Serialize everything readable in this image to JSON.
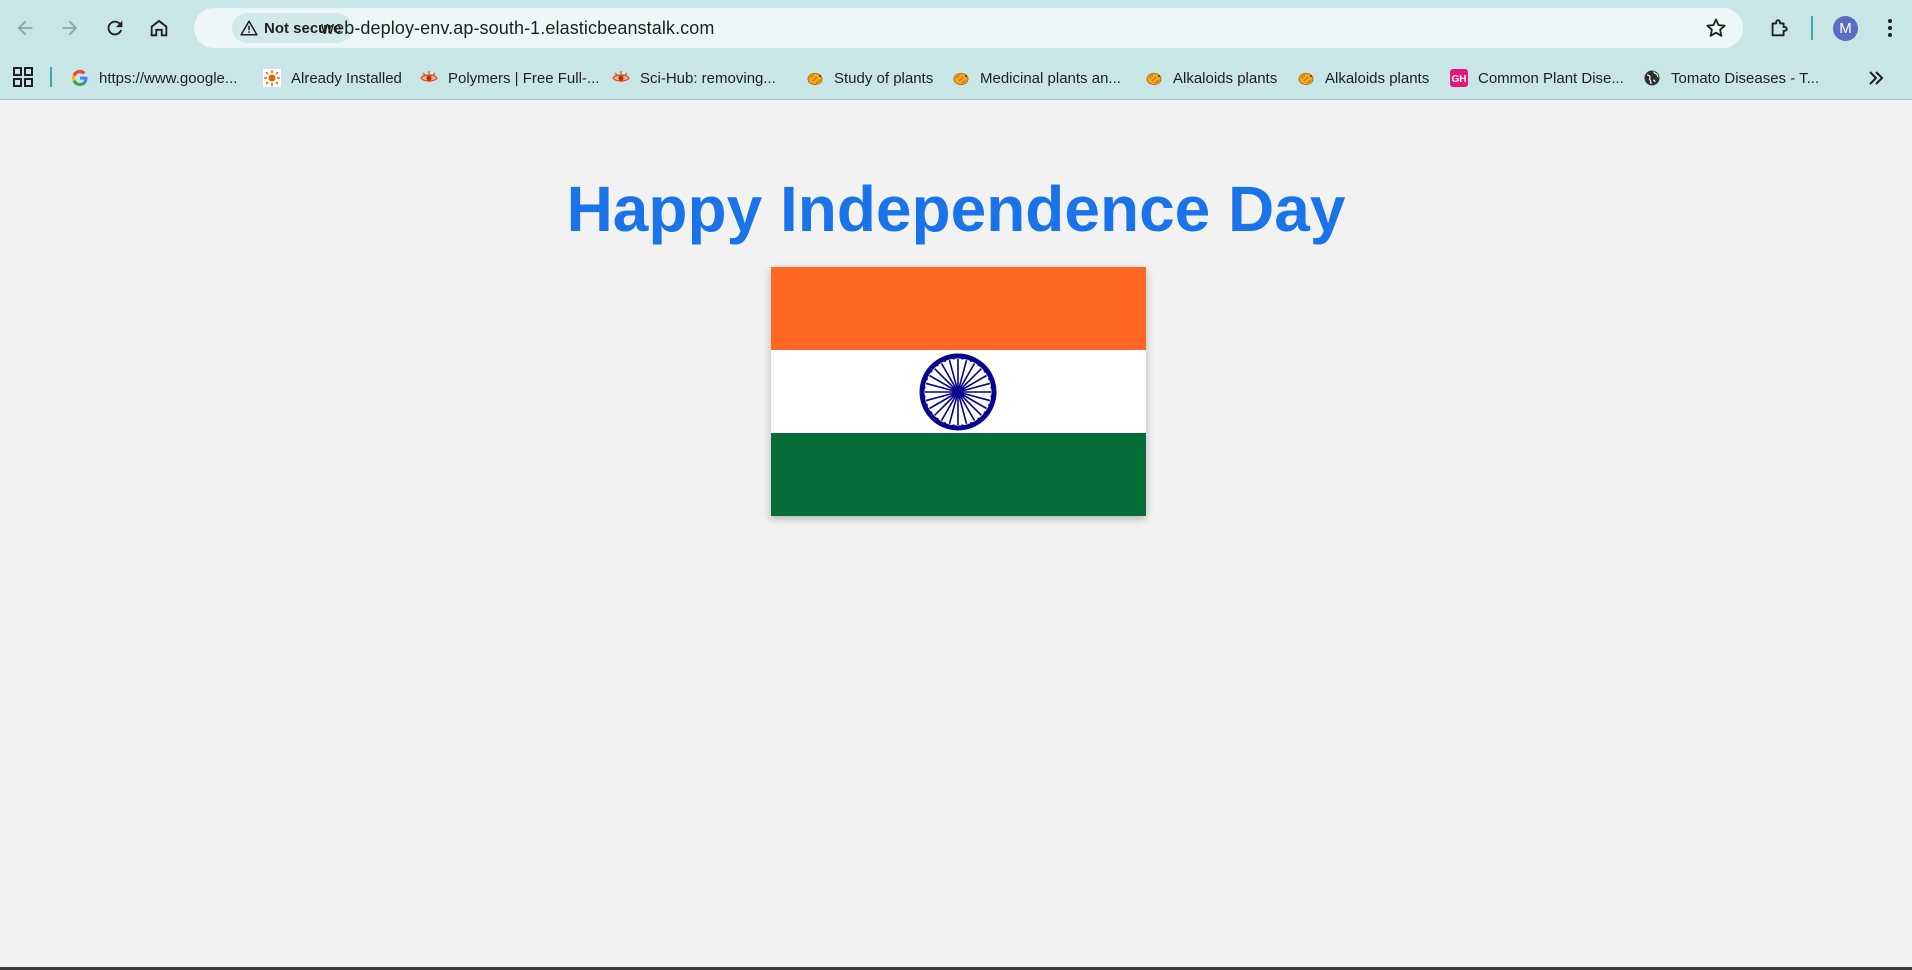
{
  "browser": {
    "security_label": "Not secure",
    "url": "web-deploy-env.ap-south-1.elasticbeanstalk.com",
    "profile_initial": "M"
  },
  "bookmarks": [
    {
      "label": "https://www.google...",
      "icon": "google-icon"
    },
    {
      "label": "Already Installed",
      "icon": "sun-icon"
    },
    {
      "label": "Polymers | Free Full-...",
      "icon": "eye-icon"
    },
    {
      "label": "Sci-Hub: removing...",
      "icon": "eye-icon"
    },
    {
      "label": "Study of plants",
      "icon": "bird-icon"
    },
    {
      "label": "Medicinal plants an...",
      "icon": "bird-icon"
    },
    {
      "label": "Alkaloids plants",
      "icon": "bird-icon"
    },
    {
      "label": "Alkaloids plants",
      "icon": "bird-icon"
    },
    {
      "label": "Common Plant Dise...",
      "icon": "gh-icon"
    },
    {
      "label": "Tomato Diseases - T...",
      "icon": "globe-icon"
    }
  ],
  "page": {
    "heading": "Happy Independence Day"
  },
  "colors": {
    "heading": "#1a73e8",
    "saffron": "#ff6723",
    "white": "#ffffff",
    "green": "#066c38",
    "chakra": "#06038d",
    "chrome": "#c8e6e6"
  }
}
